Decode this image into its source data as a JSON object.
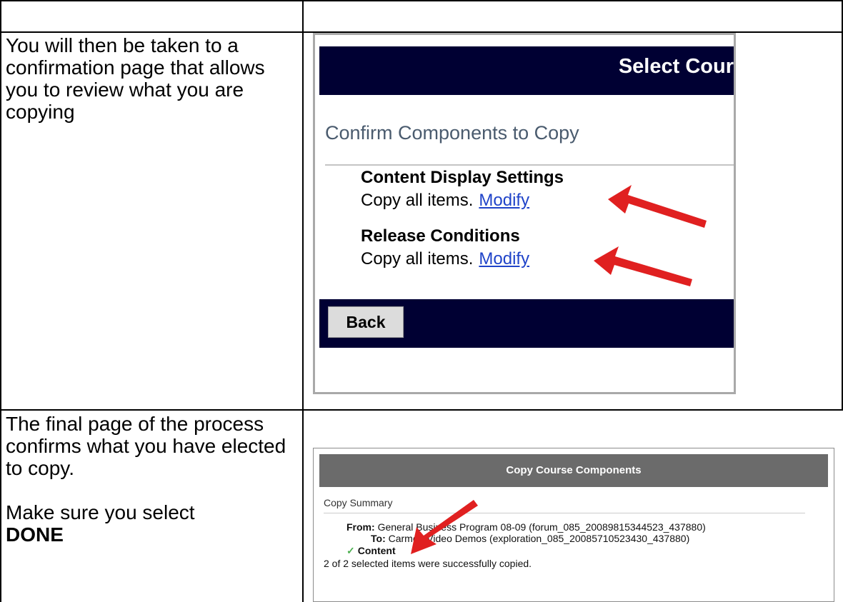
{
  "rows": [
    {
      "paragraphs": [
        "You will then be taken to a confirmation page that allows you to review what you are copying"
      ]
    },
    {
      "para1": "The final page of the process confirms what you have elected to copy.",
      "para2_prefix": "Make sure you select",
      "para2_bold": "DONE"
    }
  ],
  "screenshot1": {
    "header_title": "Select Cour",
    "confirm_heading": "Confirm Components to Copy",
    "sections": [
      {
        "title": "Content Display Settings",
        "text": "Copy all items.",
        "link": "Modify"
      },
      {
        "title": "Release Conditions",
        "text": "Copy all items.",
        "link": "Modify"
      }
    ],
    "back_label": "Back",
    "colors": {
      "bar": "#000033",
      "arrow": "#e02020",
      "link": "#1f43c9"
    }
  },
  "screenshot2": {
    "header_title": "Copy Course Components",
    "summary_label": "Copy Summary",
    "from_label": "From:",
    "from_value": "General Business Program 08-09 (forum_085_20089815344523_437880)",
    "to_label": "To:",
    "to_value": "Carmen Video Demos (exploration_085_20085710523430_437880)",
    "content_label": "Content",
    "result_text": "2 of 2 selected items were successfully copied."
  }
}
